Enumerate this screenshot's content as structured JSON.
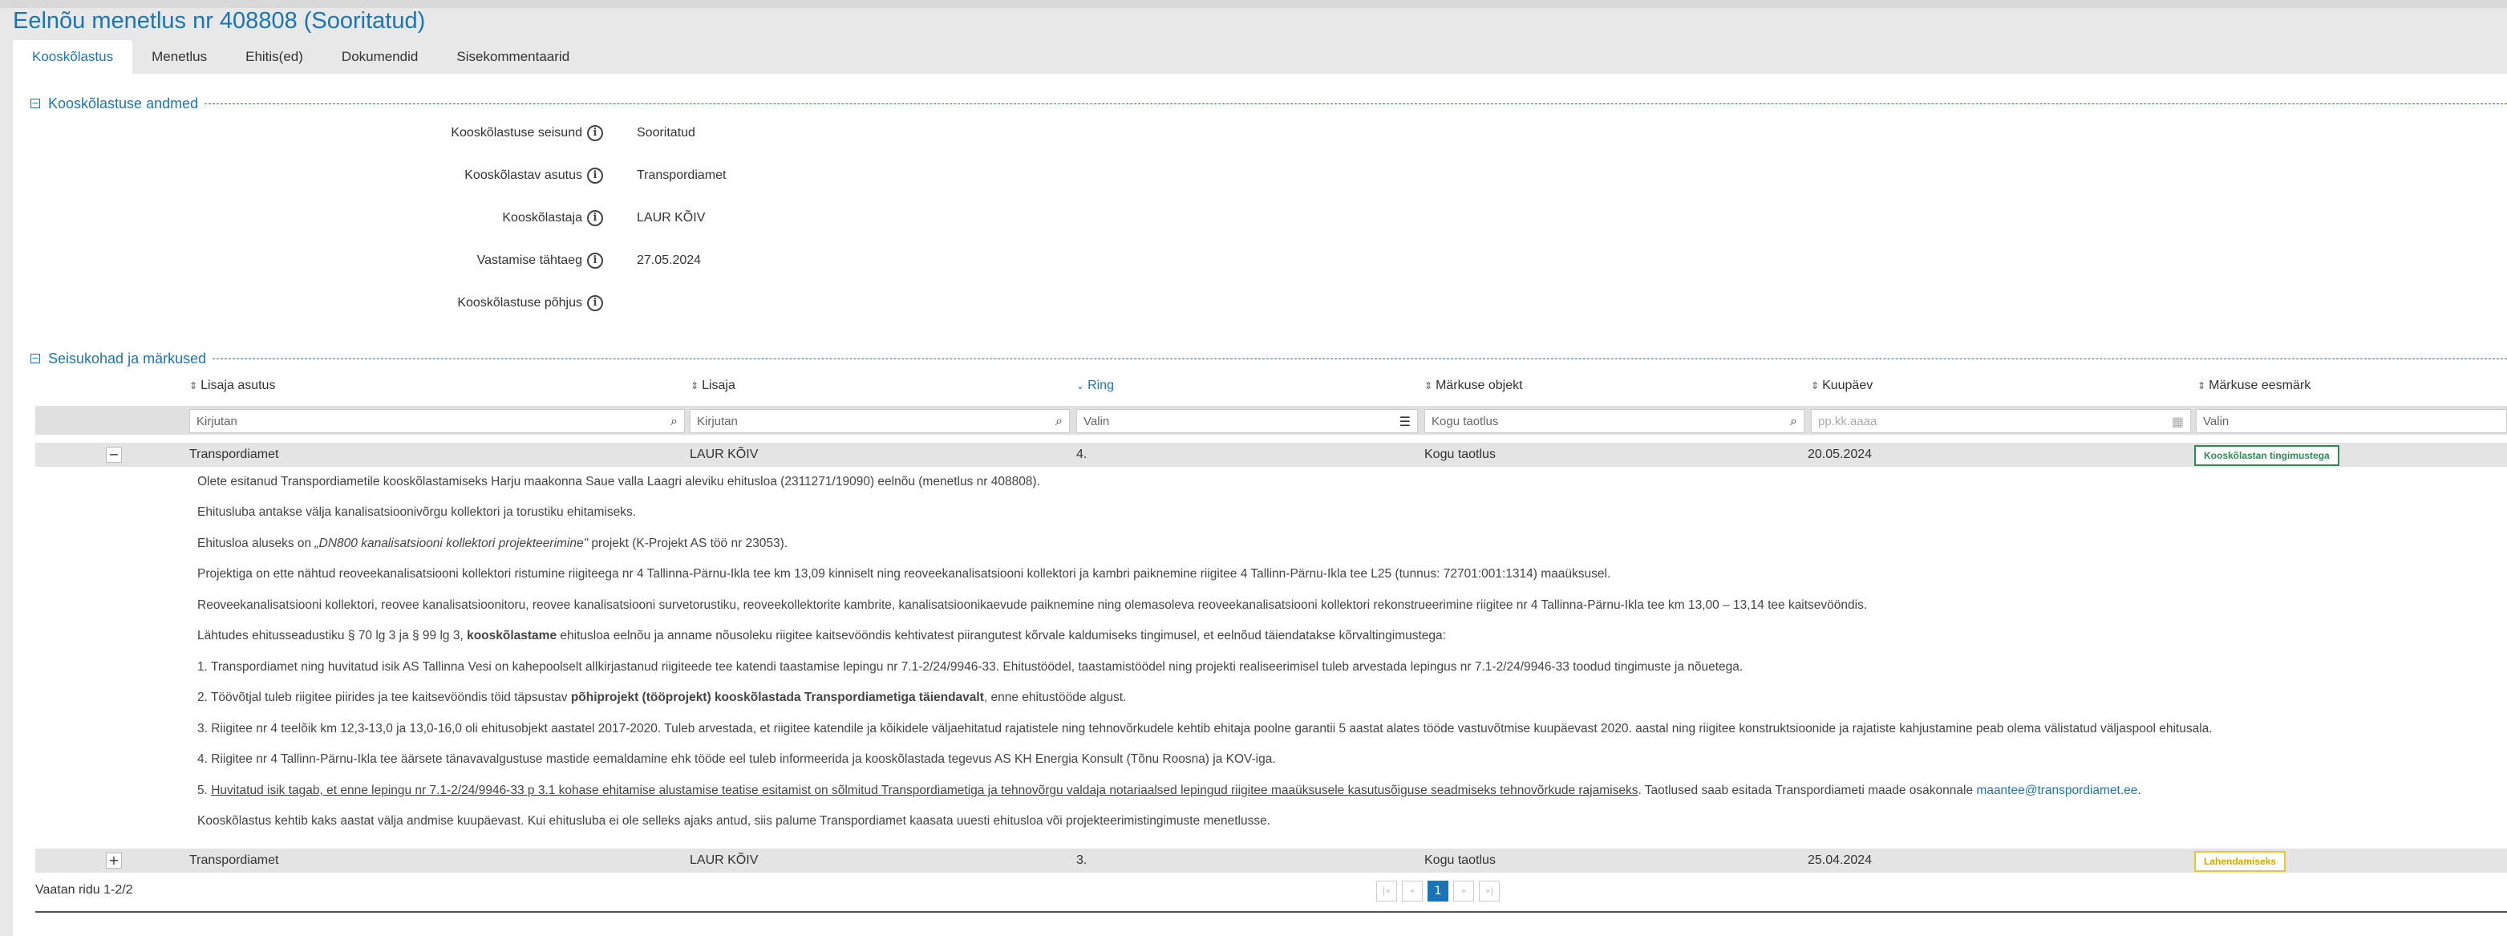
{
  "page_title": "Eelnõu menetlus nr 408808 (Sooritatud)",
  "tabs": [
    {
      "label": "Kooskõlastus"
    },
    {
      "label": "Menetlus"
    },
    {
      "label": "Ehitis(ed)"
    },
    {
      "label": "Dokumendid"
    },
    {
      "label": "Sisekommentaarid"
    }
  ],
  "section1": {
    "title": "Kooskõlastuse andmed",
    "fields": [
      {
        "label": "Kooskõlastuse seisund",
        "value": "Sooritatud"
      },
      {
        "label": "Kooskõlastav asutus",
        "value": "Transpordiamet"
      },
      {
        "label": "Kooskõlastaja",
        "value": "LAUR KÕIV"
      },
      {
        "label": "Vastamise tähtaeg",
        "value": "27.05.2024"
      },
      {
        "label": "Kooskõlastuse põhjus",
        "value": ""
      }
    ]
  },
  "section2": {
    "title": "Seisukohad ja märkused",
    "columns": [
      {
        "label": "Lisaja asutus"
      },
      {
        "label": "Lisaja"
      },
      {
        "label": "Ring"
      },
      {
        "label": "Märkuse objekt"
      },
      {
        "label": "Kuupäev"
      },
      {
        "label": "Märkuse eesmärk"
      }
    ],
    "filters": [
      {
        "placeholder": "Kirjutan"
      },
      {
        "placeholder": "Kirjutan"
      },
      {
        "placeholder": "Valin"
      },
      {
        "placeholder": "Kogu taotlus"
      },
      {
        "placeholder": "pp.kk.aaaa"
      },
      {
        "placeholder": "Valin"
      }
    ],
    "rows": [
      {
        "expander": "−",
        "asutus": "Transpordiamet",
        "lisaja": "LAUR KÕIV",
        "ring": "4.",
        "objekt": "Kogu taotlus",
        "kuupaev": "20.05.2024",
        "eesmark": "Kooskõlastan tingimustega"
      },
      {
        "expander": "+",
        "asutus": "Transpordiamet",
        "lisaja": "LAUR KÕIV",
        "ring": "3.",
        "objekt": "Kogu taotlus",
        "kuupaev": "25.04.2024",
        "eesmark": "Lahendamiseks"
      }
    ],
    "detail": {
      "p1": "Olete esitanud Transpordiametile kooskõlastamiseks Harju maakonna Saue valla Laagri aleviku ehitusloa (2311271/19090) eelnõu (menetlus nr 408808).",
      "p2": "Ehitusluba antakse välja kanalisatsioonivõrgu kollektori ja torustiku ehitamiseks.",
      "p3_a": "Ehitusloa aluseks on ",
      "p3_b": "„DN800 kanalisatsiooni kollektori projekteerimine\"",
      "p3_c": " projekt (K-Projekt AS töö nr 23053).",
      "p4": "Projektiga on ette nähtud reoveekanalisatsiooni kollektori ristumine riigiteega nr 4 Tallinna-Pärnu-Ikla tee km 13,09 kinniselt ning reoveekanalisatsiooni kollektori ja kambri paiknemine riigitee 4 Tallinn-Pärnu-Ikla tee L25 (tunnus: 72701:001:1314) maaüksusel.",
      "p5": "Reoveekanalisatsiooni kollektori, reovee kanalisatsioonitoru, reovee kanalisatsiooni survetorustiku, reoveekollektorite kambrite, kanalisatsioonikaevude paiknemine ning olemasoleva reoveekanalisatsiooni kollektori rekonstrueerimine riigitee nr 4 Tallinna-Pärnu-Ikla tee km 13,00 – 13,14 tee kaitsevööndis.",
      "p6_a": "Lähtudes ehitusseadustiku § 70 lg 3 ja § 99 lg 3, ",
      "p6_b": "kooskõlastame",
      "p6_c": " ehitusloa eelnõu ja anname nõusoleku riigitee kaitsevööndis kehtivatest piirangutest kõrvale kaldumiseks tingimusel, et eelnõud täiendatakse kõrvaltingimustega:",
      "p7": "1.  Transpordiamet ning huvitatud isik AS Tallinna Vesi on kahepoolselt allkirjastanud riigiteede tee katendi taastamise lepingu nr 7.1-2/24/9946-33. Ehitustöödel, taastamistöödel ning projekti realiseerimisel tuleb arvestada lepingus nr 7.1-2/24/9946-33 toodud tingimuste ja nõuetega.",
      "p8_a": "2.  Töövõtjal tuleb riigitee piirides ja tee kaitsevööndis töid täpsustav ",
      "p8_b": "põhiprojekt (tööprojekt) kooskõlastada Transpordiametiga täiendavalt",
      "p8_c": ", enne ehitustööde algust.",
      "p9": "3.  Riigitee nr 4 teelõik km 12,3-13,0 ja 13,0-16,0 oli ehitusobjekt aastatel 2017-2020. Tuleb arvestada, et riigitee katendile ja kõikidele väljaehitatud rajatistele ning tehnovõrkudele kehtib ehitaja poolne garantii 5 aastat alates tööde vastuvõtmise kuupäevast 2020. aastal ning riigitee konstruktsioonide ja rajatiste kahjustamine peab olema välistatud väljaspool ehitusala.",
      "p10": "4.  Riigitee nr 4 Tallinn-Pärnu-Ikla tee äärsete tänavavalgustuse mastide eemaldamine ehk tööde eel tuleb informeerida ja kooskõlastada tegevus AS KH Energia Konsult (Tõnu Roosna) ja KOV-iga.",
      "p11_a": "5.  ",
      "p11_b": "Huvitatud isik tagab, et enne lepingu nr 7.1-2/24/9946-33 p 3.1 kohase ehitamise alustamise teatise esitamist on sõlmitud Transpordiametiga ja tehnovõrgu valdaja notariaalsed lepingud riigitee maaüksusele kasutusõiguse seadmiseks tehnovõrkude rajamiseks",
      "p11_c": ". Taotlused saab esitada Transpordiameti maade osakonnale ",
      "p11_d": "maantee@transpordiamet.ee",
      "p11_e": ".",
      "p12": "Kooskõlastus kehtib kaks aastat välja andmise kuupäevast. Kui ehitusluba ei ole selleks ajaks antud, siis palume Transpordiamet kaasata uuesti ehitusloa või projekteerimistingimuste menetlusse."
    }
  },
  "footer": {
    "rows_text": "Vaatan ridu 1-2/2",
    "pager": {
      "first": "|«",
      "prev": "«",
      "current": "1",
      "next": "»",
      "last": "»|"
    }
  },
  "icons": {
    "info": "i",
    "search": "search-icon",
    "list": "list-icon",
    "calendar": "calendar-icon"
  },
  "colors": {
    "accent": "#1a75b7",
    "success": "#2e8b57",
    "warning": "#e8c832"
  }
}
